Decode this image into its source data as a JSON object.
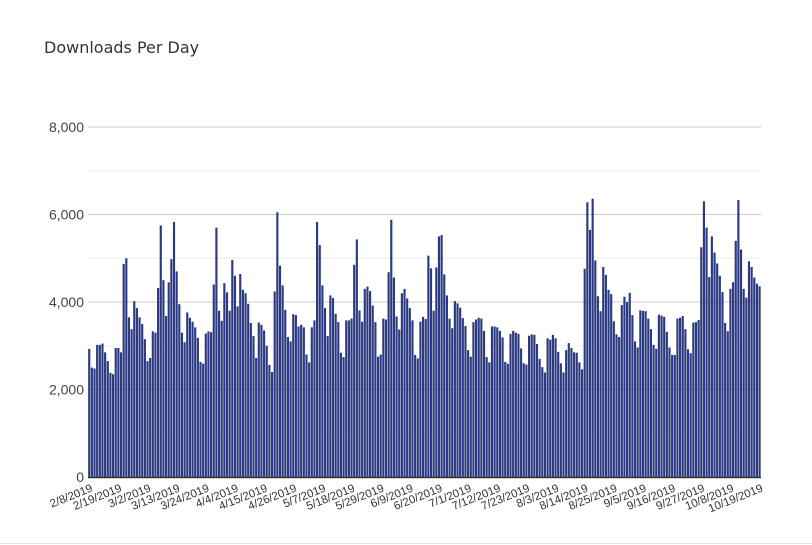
{
  "chart_data": {
    "type": "bar",
    "title": "Downloads Per Day",
    "xlabel": "",
    "ylabel": "",
    "ylim": [
      0,
      8000
    ],
    "yticks": [
      0,
      2000,
      4000,
      6000,
      8000
    ],
    "ytick_labels": [
      "0",
      "2,000",
      "4,000",
      "6,000",
      "8,000"
    ],
    "minor_gridlines": [
      1000,
      3000,
      5000,
      7000
    ],
    "grid": true,
    "legend": "none",
    "bar_color": "#2b3a80",
    "start_date": "2/8/2019",
    "tick_labels": [
      "2/8/2019",
      "2/19/2019",
      "3/2/2019",
      "3/13/2019",
      "3/24/2019",
      "4/4/2019",
      "4/15/2019",
      "4/26/2019",
      "5/7/2019",
      "5/18/2019",
      "5/29/2019",
      "6/9/2019",
      "6/20/2019",
      "7/1/2019",
      "7/12/2019",
      "7/23/2019",
      "8/3/2019",
      "8/14/2019",
      "8/25/2019",
      "9/5/2019",
      "9/16/2019",
      "9/27/2019",
      "10/8/2019",
      "10/19/2019"
    ],
    "tick_interval_days": 11,
    "values": [
      2930,
      2500,
      2480,
      3020,
      3020,
      3050,
      2850,
      2650,
      2380,
      2350,
      2950,
      2950,
      2850,
      4870,
      5000,
      3650,
      3380,
      4020,
      3860,
      3650,
      3500,
      3150,
      2650,
      2720,
      3330,
      3300,
      4320,
      5750,
      4500,
      3680,
      4450,
      4980,
      5830,
      4700,
      3950,
      3300,
      3080,
      3760,
      3640,
      3550,
      3420,
      3180,
      2630,
      2590,
      3280,
      3330,
      3310,
      4400,
      5700,
      3800,
      3570,
      4430,
      4220,
      3800,
      4960,
      4600,
      3900,
      4640,
      4280,
      4200,
      3960,
      3520,
      3220,
      2720,
      3530,
      3480,
      3350,
      3000,
      2560,
      2400,
      4240,
      6050,
      4830,
      4380,
      3820,
      3200,
      3100,
      3720,
      3700,
      3440,
      3480,
      3420,
      2800,
      2620,
      3420,
      3580,
      5830,
      5300,
      4380,
      3860,
      3220,
      4150,
      4090,
      3730,
      3540,
      2840,
      2740,
      3580,
      3580,
      3620,
      4850,
      5430,
      3810,
      3550,
      4300,
      4350,
      4250,
      3920,
      3540,
      2750,
      2800,
      3620,
      3600,
      4680,
      5880,
      4560,
      3670,
      3370,
      4200,
      4300,
      4080,
      3860,
      3580,
      2790,
      2710,
      3550,
      3660,
      3610,
      5060,
      4770,
      3800,
      4790,
      5500,
      5530,
      4630,
      4150,
      3620,
      3400,
      4020,
      3970,
      3870,
      3630,
      3450,
      2900,
      2750,
      3540,
      3600,
      3640,
      3620,
      3340,
      2740,
      2620,
      3440,
      3440,
      3420,
      3340,
      3190,
      2630,
      2590,
      3270,
      3340,
      3300,
      3270,
      2940,
      2600,
      2570,
      3230,
      3260,
      3250,
      3040,
      2700,
      2510,
      2390,
      3170,
      3140,
      3250,
      3170,
      2860,
      2600,
      2390,
      2900,
      3060,
      2950,
      2850,
      2840,
      2620,
      2460,
      4760,
      6280,
      5650,
      6360,
      4950,
      4130,
      3790,
      4800,
      4620,
      4280,
      4180,
      3560,
      3260,
      3200,
      3930,
      4120,
      4000,
      4210,
      3700,
      3100,
      2960,
      3810,
      3800,
      3790,
      3620,
      3380,
      3020,
      2930,
      3710,
      3690,
      3660,
      3320,
      2960,
      2790,
      2790,
      3620,
      3640,
      3680,
      3380,
      2920,
      2830,
      3530,
      3540,
      3590,
      5250,
      6300,
      5700,
      4570,
      5500,
      5130,
      4880,
      4600,
      4230,
      3520,
      3330,
      4300,
      4450,
      5400,
      6330,
      5200,
      4300,
      4100,
      4930,
      4800,
      4560,
      4420,
      4360
    ]
  }
}
